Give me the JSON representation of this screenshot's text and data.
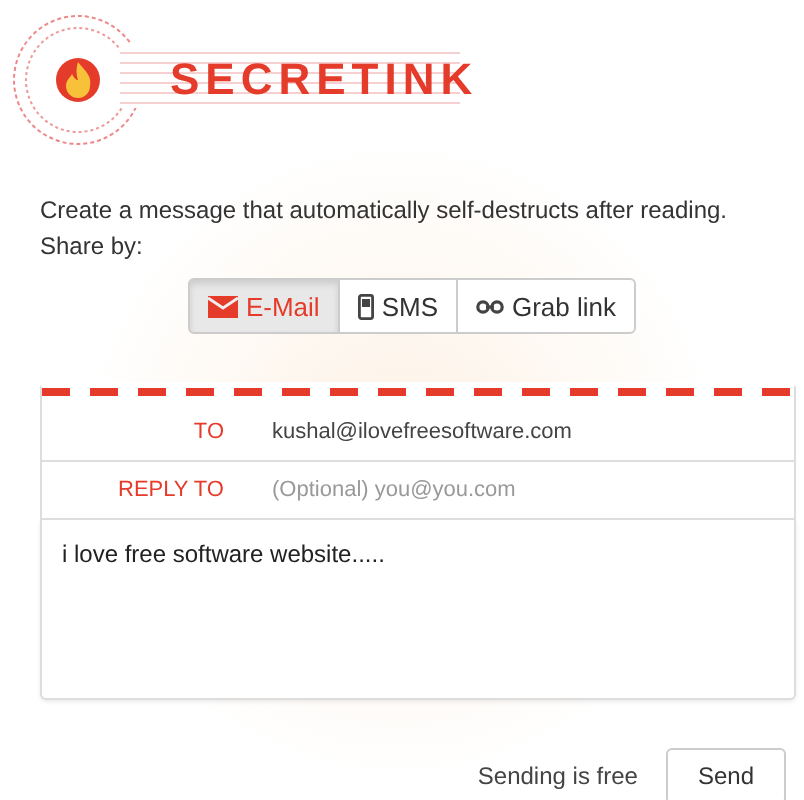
{
  "brand": {
    "name": "SECRETINK"
  },
  "intro": "Create a message that automatically self-destructs after reading.",
  "share_label": "Share by:",
  "tabs": [
    {
      "label": "E-Mail",
      "kind": "mail",
      "selected": true
    },
    {
      "label": "SMS",
      "kind": "phone",
      "selected": false
    },
    {
      "label": "Grab link",
      "kind": "link",
      "selected": false
    }
  ],
  "form": {
    "fields": [
      {
        "label": "TO",
        "value": "kushal@ilovefreesoftware.com"
      },
      {
        "label": "REPLY TO",
        "placeholder": "(Optional) you@you.com"
      }
    ],
    "message": "i love free software website....."
  },
  "footer": {
    "note": "Sending is free",
    "button": "Send"
  }
}
